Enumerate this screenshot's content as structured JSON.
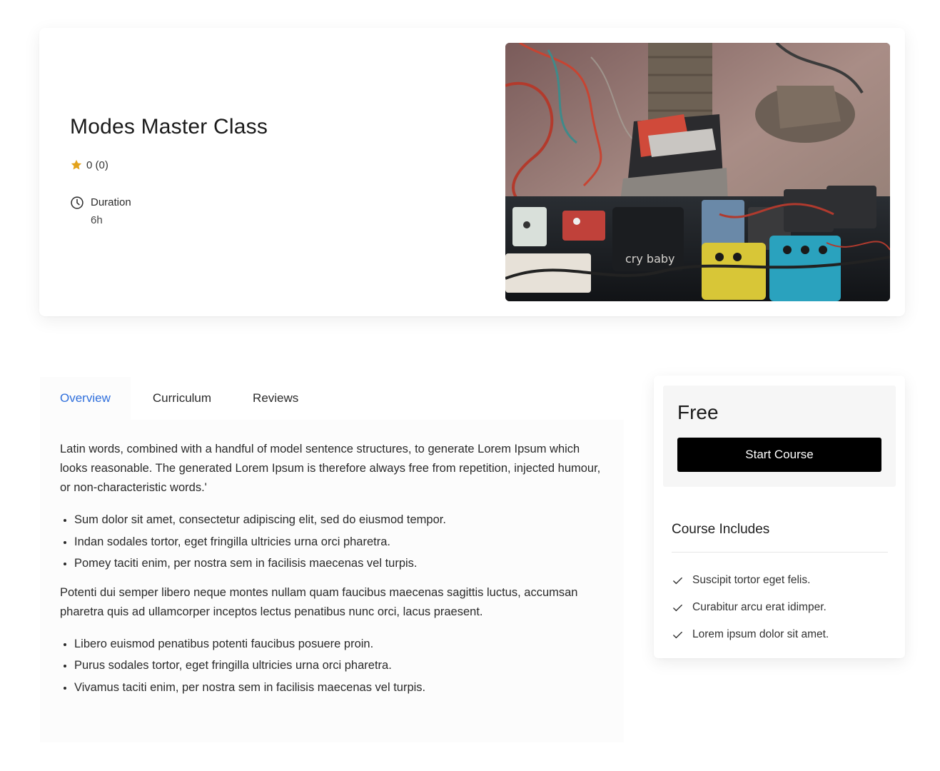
{
  "course": {
    "title": "Modes Master Class",
    "rating": "0 (0)",
    "duration_label": "Duration",
    "duration_value": "6h",
    "image_label": "cry baby"
  },
  "tabs": [
    {
      "label": "Overview",
      "active": true
    },
    {
      "label": "Curriculum",
      "active": false
    },
    {
      "label": "Reviews",
      "active": false
    }
  ],
  "overview": {
    "paragraph1": "Latin words, combined with a handful of model sentence structures, to generate Lorem Ipsum which looks reasonable. The generated Lorem Ipsum is therefore always free from repetition, injected humour, or non-characteristic words.'",
    "list1": [
      "Sum dolor sit amet, consectetur adipiscing elit, sed do eiusmod tempor.",
      "Indan sodales tortor, eget fringilla ultricies urna orci pharetra.",
      "Pomey taciti enim, per nostra sem in facilisis maecenas vel turpis."
    ],
    "paragraph2": "Potenti dui semper libero neque montes nullam quam faucibus maecenas sagittis luctus, accumsan pharetra quis ad ullamcorper inceptos lectus penatibus nunc orci, lacus praesent.",
    "list2": [
      "Libero euismod penatibus potenti faucibus posuere proin.",
      "Purus sodales tortor, eget fringilla ultricies urna orci pharetra.",
      "Vivamus taciti enim, per nostra sem in facilisis maecenas vel turpis."
    ]
  },
  "sidebar": {
    "price": "Free",
    "button_label": "Start Course",
    "includes_title": "Course Includes",
    "includes": [
      "Suscipit tortor eget felis.",
      "Curabitur arcu erat idimper.",
      "Lorem ipsum dolor sit amet."
    ]
  },
  "colors": {
    "accent": "#2f6fdc",
    "star": "#e3a21a",
    "button_bg": "#000000"
  },
  "icons": {
    "rating": "star-icon",
    "duration": "clock-icon",
    "include_item": "check-icon"
  }
}
